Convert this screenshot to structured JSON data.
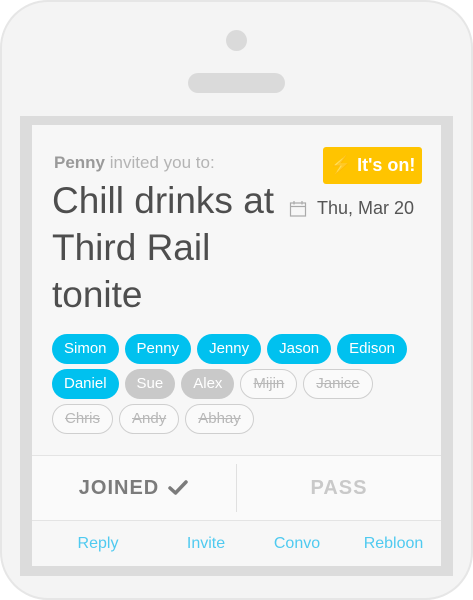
{
  "invite": {
    "inviter": "Penny",
    "invited_text": "invited you to:",
    "status_badge": "It's on!",
    "title": "Chill drinks at Third Rail tonite",
    "date": "Thu, Mar 20"
  },
  "attendees": {
    "row1": [
      "Simon",
      "Penny",
      "Jenny",
      "Jason",
      "Edison"
    ],
    "row2": [
      "Daniel",
      "Sue",
      "Alex",
      "Mijin",
      "Janice"
    ],
    "row3": [
      "Chris",
      "Andy",
      "Abhay"
    ]
  },
  "actions": {
    "joined_label": "JOINED",
    "pass_label": "PASS"
  },
  "footer": {
    "reply": "Reply",
    "invite": "Invite",
    "convo": "Convo",
    "rebloon": "Rebloon"
  },
  "colors": {
    "accent": "#00c1ef",
    "badge": "#ffc400",
    "maybe": "#c9c9c9"
  }
}
